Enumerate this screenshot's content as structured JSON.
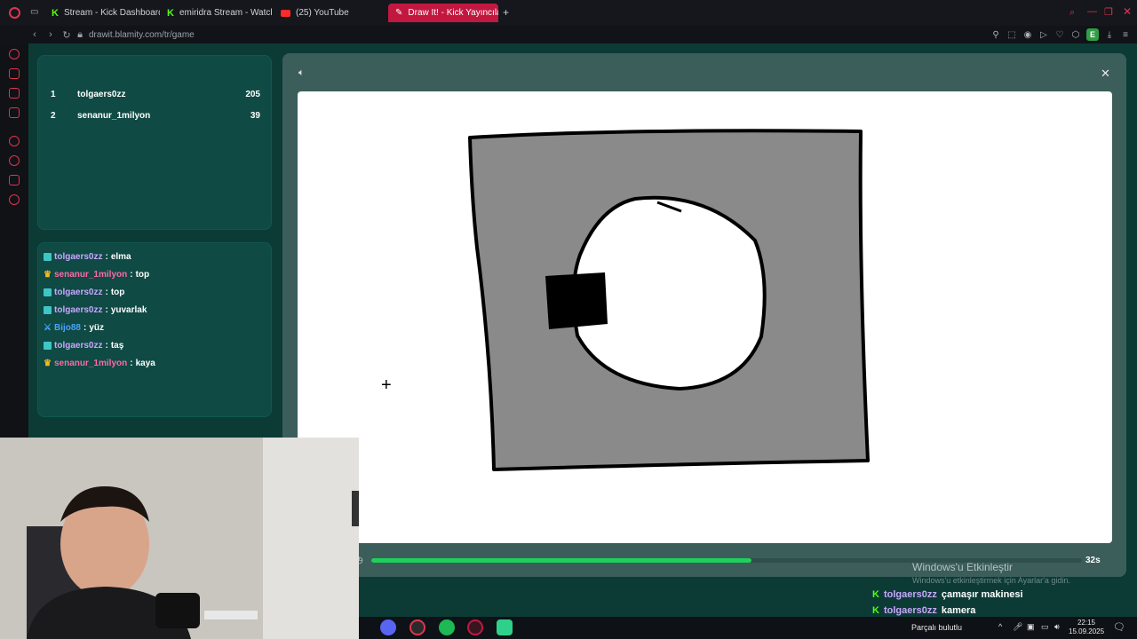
{
  "browser": {
    "tabs": [
      {
        "label": "Stream - Kick Dashboard",
        "icon": "kick-icon"
      },
      {
        "label": "emiridra Stream - Watch",
        "icon": "kick-icon"
      },
      {
        "label": "(25) YouTube",
        "icon": "youtube-icon"
      },
      {
        "label": "Draw It! - Kick Yayıncıları İç",
        "icon": "drawit-icon",
        "active": true
      }
    ],
    "url": "drawit.blamity.com/tr/game",
    "profile_initial": "E"
  },
  "leaderboard": [
    {
      "rank": "1",
      "name": "tolgaers0zz",
      "score": "205"
    },
    {
      "rank": "2",
      "name": "senanur_1milyon",
      "score": "39"
    }
  ],
  "chat": [
    {
      "badge": "grid",
      "name": "tolgaers0zz",
      "name_color": "purple",
      "message": "elma"
    },
    {
      "badge": "crown",
      "name": "senanur_1milyon",
      "name_color": "pink",
      "message": "top"
    },
    {
      "badge": "grid",
      "name": "tolgaers0zz",
      "name_color": "purple",
      "message": "top"
    },
    {
      "badge": "grid",
      "name": "tolgaers0zz",
      "name_color": "purple",
      "message": "yuvarlak"
    },
    {
      "badge": "sword",
      "name": "Bijo88",
      "name_color": "blue",
      "message": "yüz"
    },
    {
      "badge": "grid",
      "name": "tolgaers0zz",
      "name_color": "purple",
      "message": "taş"
    },
    {
      "badge": "crown",
      "name": "senanur_1milyon",
      "name_color": "pink",
      "message": "kaya"
    }
  ],
  "game": {
    "timer_label": "32s",
    "timer_progress": 0.535
  },
  "watermark": {
    "title": "Windows'u Etkinleştir",
    "subtitle": "Windows'u etkinleştirmek için Ayarlar'a gidin."
  },
  "kick_overlay": [
    {
      "name": "tolgaers0zz",
      "message": "çamaşır makinesi"
    },
    {
      "name": "tolgaers0zz",
      "message": "kamera"
    },
    {
      "name": "tolgaers0zz",
      "message": ""
    }
  ],
  "taskbar": {
    "network_status": "Parçalı bulutlu",
    "time": "22:15",
    "date": "15.09.2025"
  },
  "colors": {
    "accent_kick": "#53fc18",
    "page_bg": "#0c3b36",
    "timer_fill": "#1fd05a",
    "active_tab": "#c21840"
  }
}
